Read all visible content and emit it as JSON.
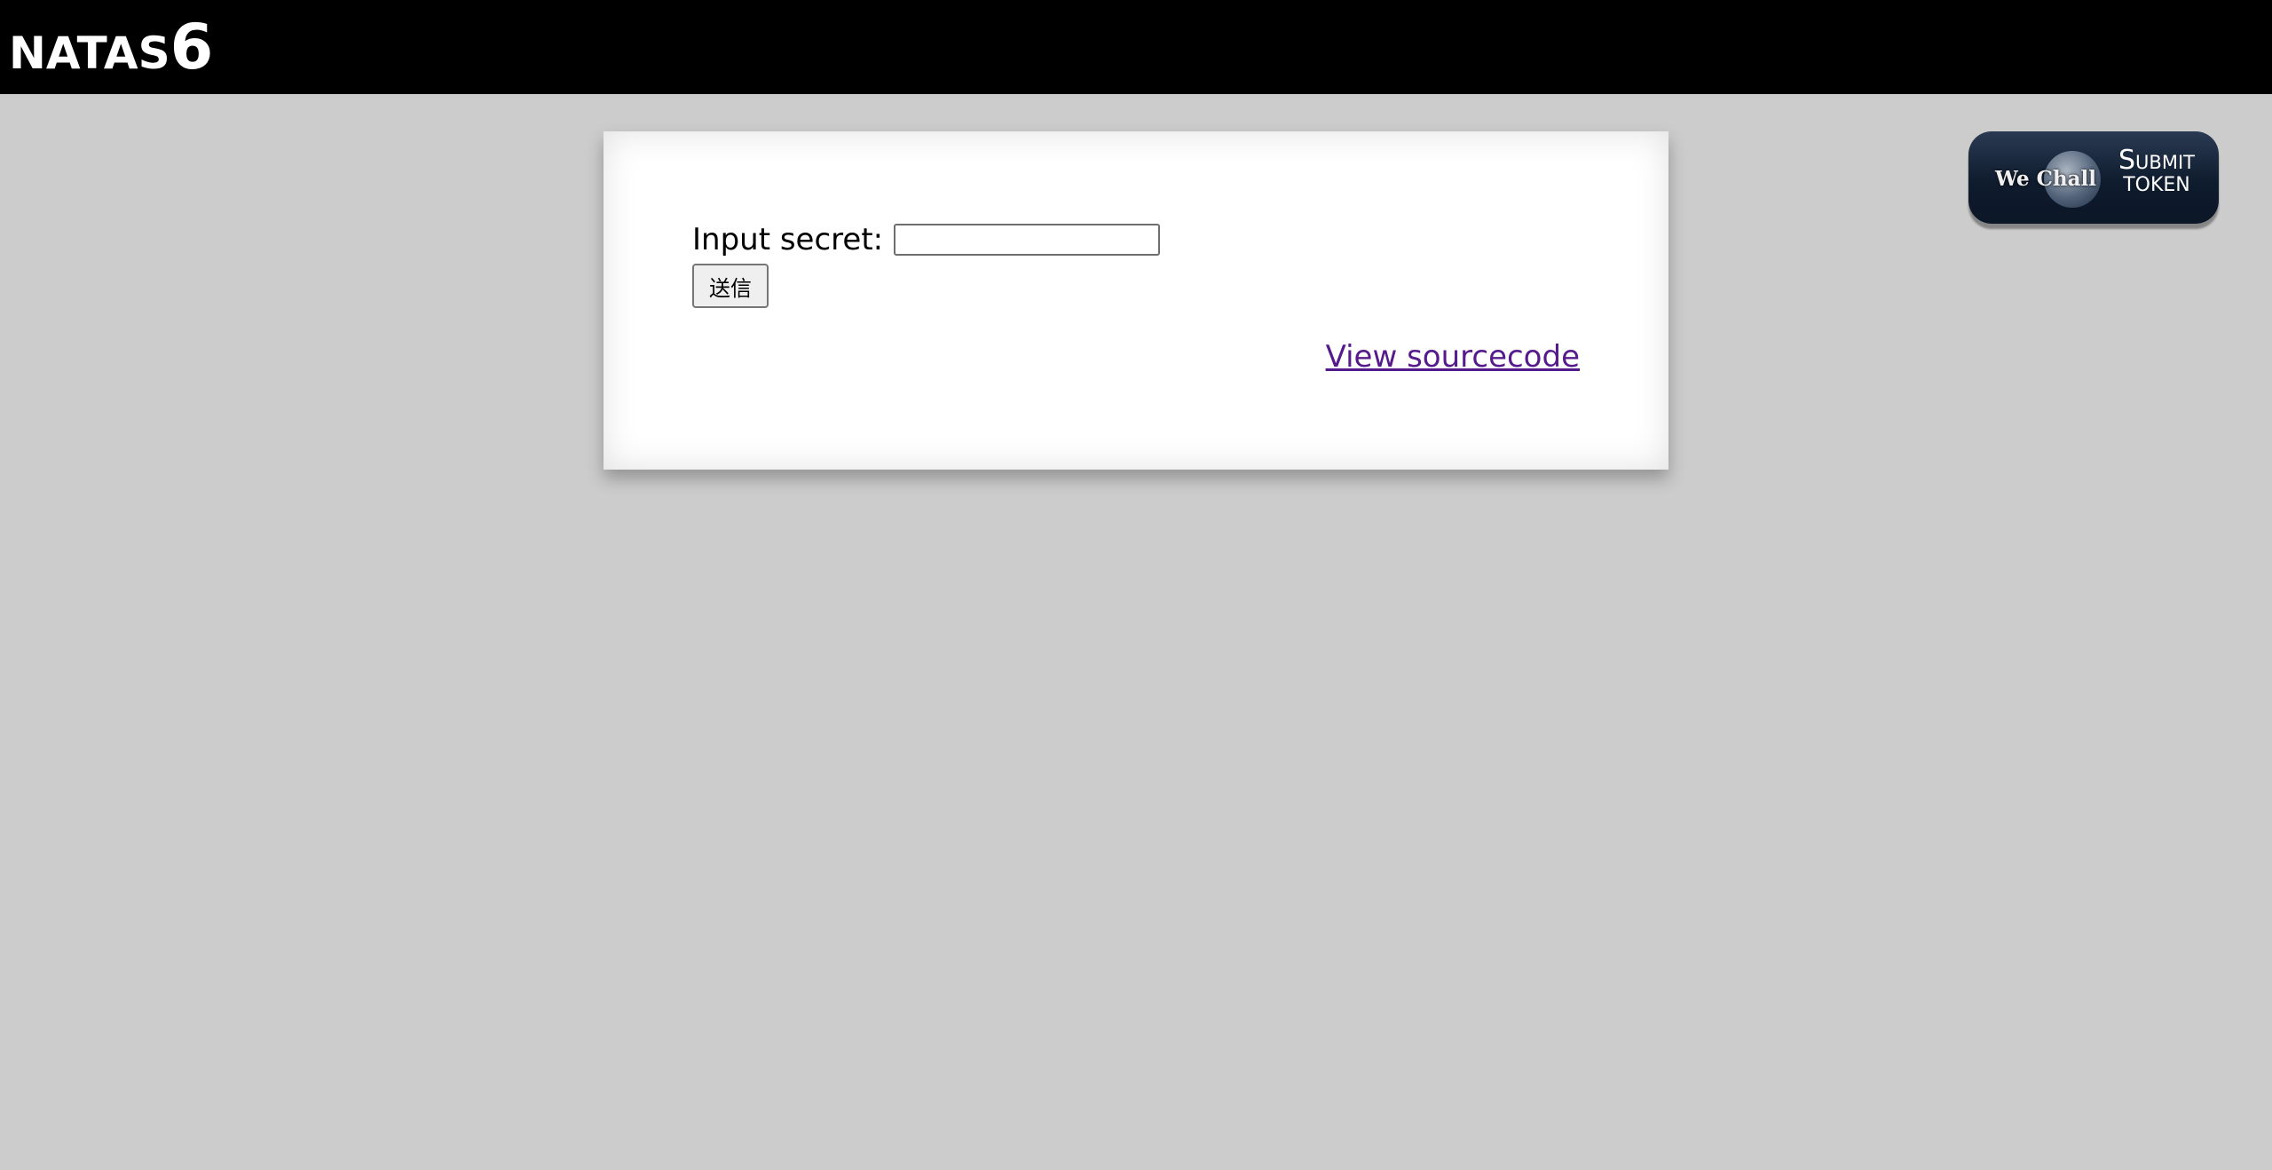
{
  "header": {
    "title_word": "NATAS",
    "title_number": "6"
  },
  "form": {
    "label": "Input secret:",
    "input_value": "",
    "submit_label": "送信"
  },
  "links": {
    "view_source": "View sourcecode"
  },
  "wechall": {
    "logo_text": "We Chall",
    "line1": "Submit",
    "line2": "TOKEN"
  },
  "colors": {
    "header_bg": "#000000",
    "page_bg": "#cccccc",
    "link_visited": "#551a8b"
  }
}
